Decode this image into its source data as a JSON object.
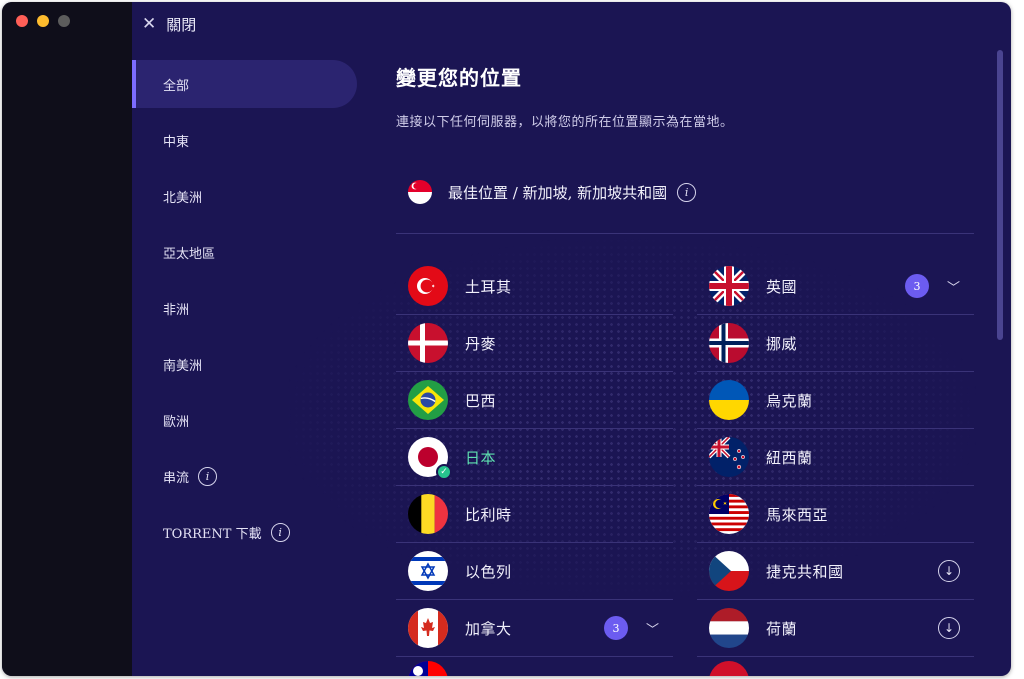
{
  "window": {
    "traffic_colors": [
      "#ff5f57",
      "#febc2e",
      "#5c5c5c"
    ]
  },
  "topbar": {
    "close_label": "關閉"
  },
  "sidebar": {
    "items": [
      {
        "label": "全部",
        "active": true
      },
      {
        "label": "中東"
      },
      {
        "label": "北美洲"
      },
      {
        "label": "亞太地區"
      },
      {
        "label": "非洲"
      },
      {
        "label": "南美洲"
      },
      {
        "label": "歐洲"
      },
      {
        "label": "串流",
        "info": true
      },
      {
        "label": "TORRENT 下載",
        "info": true
      }
    ]
  },
  "main": {
    "title": "變更您的位置",
    "subtitle": "連接以下任何伺服器，以將您的所在位置顯示為在當地。",
    "best_location": "最佳位置 / 新加坡, 新加坡共和國"
  },
  "locations": {
    "left": [
      {
        "name": "土耳其",
        "flag": "turkey-flag"
      },
      {
        "name": "丹麥",
        "flag": "denmark-flag"
      },
      {
        "name": "巴西",
        "flag": "brazil-flag"
      },
      {
        "name": "日本",
        "flag": "japan-flag",
        "connected": true
      },
      {
        "name": "比利時",
        "flag": "belgium-flag"
      },
      {
        "name": "以色列",
        "flag": "israel-flag"
      },
      {
        "name": "加拿大",
        "flag": "canada-flag",
        "count": "3"
      }
    ],
    "right": [
      {
        "name": "英國",
        "flag": "uk-flag",
        "count": "3"
      },
      {
        "name": "挪威",
        "flag": "norway-flag"
      },
      {
        "name": "烏克蘭",
        "flag": "ukraine-flag"
      },
      {
        "name": "紐西蘭",
        "flag": "new-zealand-flag"
      },
      {
        "name": "馬來西亞",
        "flag": "malaysia-flag"
      },
      {
        "name": "捷克共和國",
        "flag": "czech-flag",
        "download": true
      },
      {
        "name": "荷蘭",
        "flag": "netherlands-flag",
        "download": true
      }
    ]
  },
  "colors": {
    "background": "#1b1553",
    "accent": "#7c6cff",
    "badge": "#6c5cf0",
    "connected": "#5fe0b0"
  }
}
